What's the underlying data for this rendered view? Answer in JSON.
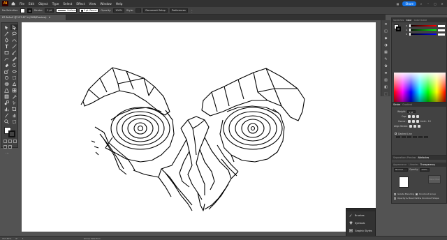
{
  "menubar": {
    "logo": "Ai",
    "items": [
      "File",
      "Edit",
      "Object",
      "Type",
      "Select",
      "Effect",
      "View",
      "Window",
      "Help"
    ],
    "share_label": "Share"
  },
  "control": {
    "selection": "No Selection",
    "stroke_label": "Stroke:",
    "stroke_weight": "1 pt",
    "profile": "Uniform",
    "brush": "3 pt. Round",
    "opacity_label": "Opacity:",
    "opacity_value": "100%",
    "style_label": "Style:",
    "doc_setup": "Document Setup",
    "preferences": "Preferences"
  },
  "document": {
    "tab_title": "87.3ef.ai* @ 157.87 % (RGB/Preview)"
  },
  "panels": {
    "color_tabs": [
      "Swatches",
      "Color",
      "Color Guide"
    ],
    "color_active": "Color",
    "channels": [
      "R",
      "G",
      "B"
    ],
    "stroke_tabs": [
      "Stroke",
      "Gradient"
    ],
    "stroke_weight_label": "Weight:",
    "stroke_weight_value": "1 pt",
    "cap_label": "Cap:",
    "corner_label": "Corner:",
    "limit_label": "Limit:",
    "limit_value": "10",
    "align_label": "Align Stroke:",
    "dashed_label": "Dashed Line",
    "trans_tabs": [
      "Appearance",
      "Libraries",
      "Transparency"
    ],
    "trans_top_tabs": [
      "Separations Preview",
      "Attributes"
    ],
    "blend_mode": "Normal",
    "opacity_label": "Opacity:",
    "opacity_value": "100%",
    "make_mask": "Make Mask",
    "isolate_blending": "Isolate Blending",
    "knockout_group": "Knockout Group",
    "opacity_mask": "Opacity & Mask Define Knockout Shape"
  },
  "float_panel": {
    "items": [
      "Brushes",
      "Symbols",
      "Graphic Styles"
    ]
  },
  "status": {
    "zoom": "157.87%",
    "rotation": "0°",
    "artboard": "1",
    "tool": "Group Selection"
  }
}
